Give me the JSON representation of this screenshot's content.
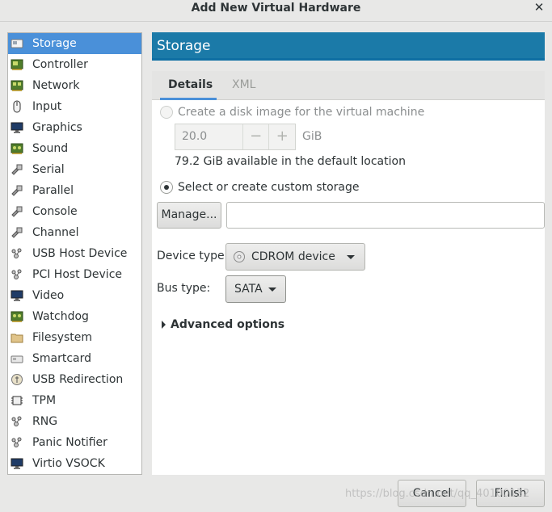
{
  "window": {
    "title": "Add New Virtual Hardware",
    "close_glyph": "✕"
  },
  "sidebar": {
    "items": [
      {
        "label": "Storage",
        "icon": "storage-icon",
        "selected": true
      },
      {
        "label": "Controller",
        "icon": "controller-icon"
      },
      {
        "label": "Network",
        "icon": "network-icon"
      },
      {
        "label": "Input",
        "icon": "mouse-icon"
      },
      {
        "label": "Graphics",
        "icon": "monitor-icon"
      },
      {
        "label": "Sound",
        "icon": "sound-card-icon"
      },
      {
        "label": "Serial",
        "icon": "serial-plug-icon"
      },
      {
        "label": "Parallel",
        "icon": "parallel-plug-icon"
      },
      {
        "label": "Console",
        "icon": "console-plug-icon"
      },
      {
        "label": "Channel",
        "icon": "channel-plug-icon"
      },
      {
        "label": "USB Host Device",
        "icon": "usb-host-icon"
      },
      {
        "label": "PCI Host Device",
        "icon": "pci-host-icon"
      },
      {
        "label": "Video",
        "icon": "video-monitor-icon"
      },
      {
        "label": "Watchdog",
        "icon": "watchdog-icon"
      },
      {
        "label": "Filesystem",
        "icon": "folder-icon"
      },
      {
        "label": "Smartcard",
        "icon": "smartcard-icon"
      },
      {
        "label": "USB Redirection",
        "icon": "usb-redirection-icon"
      },
      {
        "label": "TPM",
        "icon": "tpm-chip-icon"
      },
      {
        "label": "RNG",
        "icon": "rng-icon"
      },
      {
        "label": "Panic Notifier",
        "icon": "panic-notifier-icon"
      },
      {
        "label": "Virtio VSOCK",
        "icon": "vsock-monitor-icon"
      }
    ]
  },
  "header": {
    "title": "Storage"
  },
  "tabs": {
    "details": "Details",
    "xml": "XML"
  },
  "storage": {
    "create_disk_label": "Create a disk image for the virtual machine",
    "size_value": "20.0",
    "size_unit": "GiB",
    "minus": "−",
    "plus": "+",
    "available_text": "79.2 GiB available in the default location",
    "custom_storage_label": "Select or create custom storage",
    "manage_button": "Manage...",
    "path_value": "",
    "device_type_label": "Device type:",
    "device_type_value": "CDROM device",
    "bus_type_label": "Bus type:",
    "bus_type_value": "SATA",
    "advanced_label": "Advanced options"
  },
  "footer": {
    "cancel": "Cancel",
    "finish": "Finish"
  },
  "watermark": "https://blog.csdn.net/qq_40100132",
  "colors": {
    "accent": "#4a90d9",
    "header_bg": "#1b7aa8"
  }
}
